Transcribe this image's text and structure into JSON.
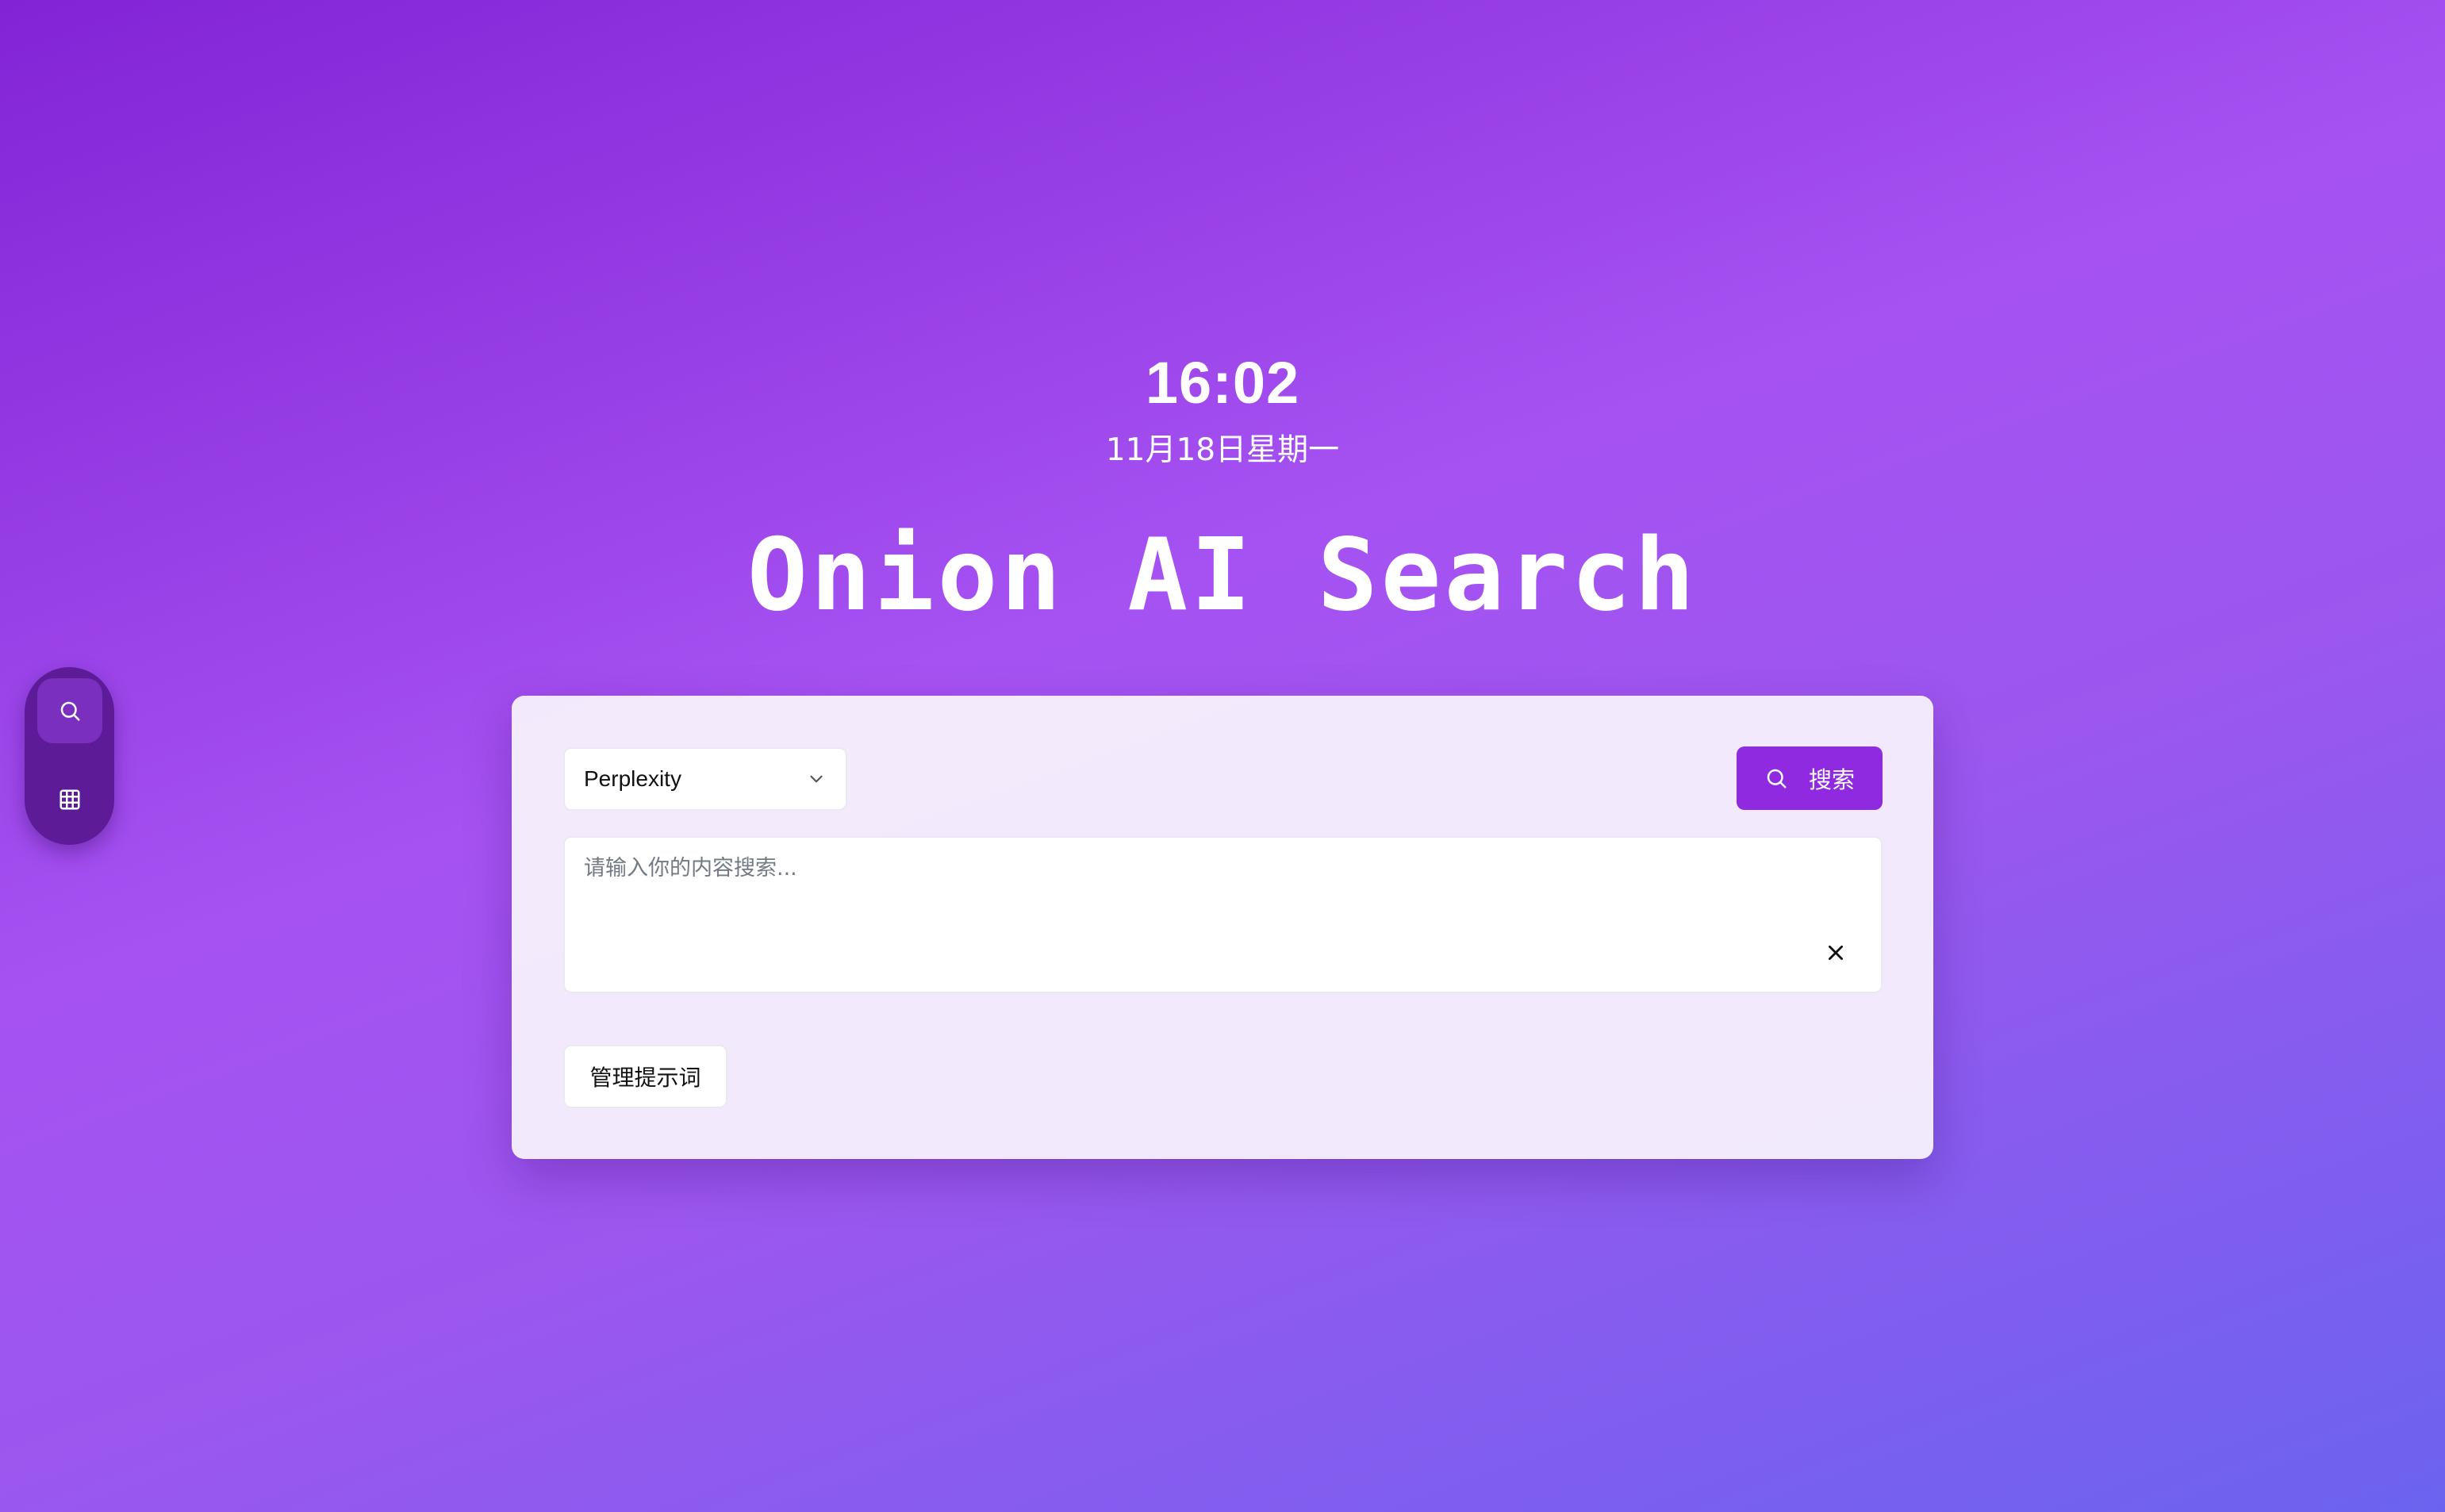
{
  "dock": {
    "items": [
      {
        "icon": "search-icon",
        "active": true
      },
      {
        "icon": "grid-icon",
        "active": false
      }
    ]
  },
  "clock": {
    "time": "16:02",
    "date": "11月18日星期一"
  },
  "brand": {
    "title": "Onion AI Search"
  },
  "search": {
    "engine": "Perplexity",
    "button_label": "搜索",
    "placeholder": "请输入你的内容搜索...",
    "value": "",
    "manage_label": "管理提示词"
  },
  "colors": {
    "accent": "#8f2ae0",
    "dock_bg": "#5e1b98",
    "gradient_start": "#8224d6",
    "gradient_end": "#6b63ef"
  }
}
